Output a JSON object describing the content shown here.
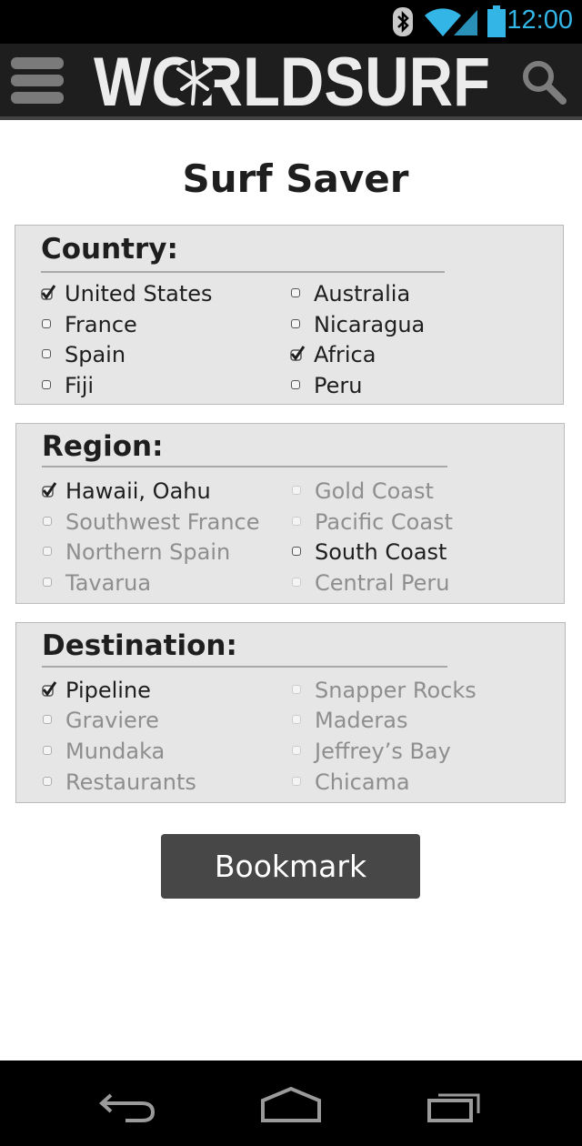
{
  "status_bar": {
    "time": "12:00",
    "icons": [
      "bluetooth-icon",
      "wifi-icon",
      "signal-icon",
      "battery-icon"
    ],
    "accent_color": "#33b5e5"
  },
  "app_bar": {
    "logo_text": "WORLDSURF",
    "menu_icon": "menu-icon",
    "search_icon": "search-icon"
  },
  "page_title": "Surf Saver",
  "sections": [
    {
      "heading": "Country:",
      "options": [
        {
          "label": "United States",
          "checked": true,
          "enabled": true
        },
        {
          "label": "Australia",
          "checked": false,
          "enabled": true
        },
        {
          "label": "France",
          "checked": false,
          "enabled": true
        },
        {
          "label": "Nicaragua",
          "checked": false,
          "enabled": true
        },
        {
          "label": "Spain",
          "checked": false,
          "enabled": true
        },
        {
          "label": "Africa",
          "checked": true,
          "enabled": true
        },
        {
          "label": "Fiji",
          "checked": false,
          "enabled": true
        },
        {
          "label": "Peru",
          "checked": false,
          "enabled": true
        }
      ]
    },
    {
      "heading": "Region:",
      "options": [
        {
          "label": "Hawaii, Oahu",
          "checked": true,
          "enabled": true
        },
        {
          "label": "Gold Coast",
          "checked": false,
          "enabled": false
        },
        {
          "label": "Southwest France",
          "checked": false,
          "enabled": false
        },
        {
          "label": "Pacific Coast",
          "checked": false,
          "enabled": false
        },
        {
          "label": "Northern Spain",
          "checked": false,
          "enabled": false
        },
        {
          "label": "South Coast",
          "checked": false,
          "enabled": true
        },
        {
          "label": "Tavarua",
          "checked": false,
          "enabled": false
        },
        {
          "label": "Central Peru",
          "checked": false,
          "enabled": false
        }
      ]
    },
    {
      "heading": "Destination:",
      "options": [
        {
          "label": "Pipeline",
          "checked": true,
          "enabled": true
        },
        {
          "label": "Snapper Rocks",
          "checked": false,
          "enabled": false
        },
        {
          "label": "Graviere",
          "checked": false,
          "enabled": false
        },
        {
          "label": "Maderas",
          "checked": false,
          "enabled": false
        },
        {
          "label": "Mundaka",
          "checked": false,
          "enabled": false
        },
        {
          "label": "Jeffrey’s Bay",
          "checked": false,
          "enabled": false
        },
        {
          "label": "Restaurants",
          "checked": false,
          "enabled": false
        },
        {
          "label": "Chicama",
          "checked": false,
          "enabled": false
        }
      ]
    }
  ],
  "bookmark_label": "Bookmark",
  "nav_bar": {
    "buttons": [
      "back-icon",
      "home-icon",
      "recent-apps-icon"
    ]
  }
}
